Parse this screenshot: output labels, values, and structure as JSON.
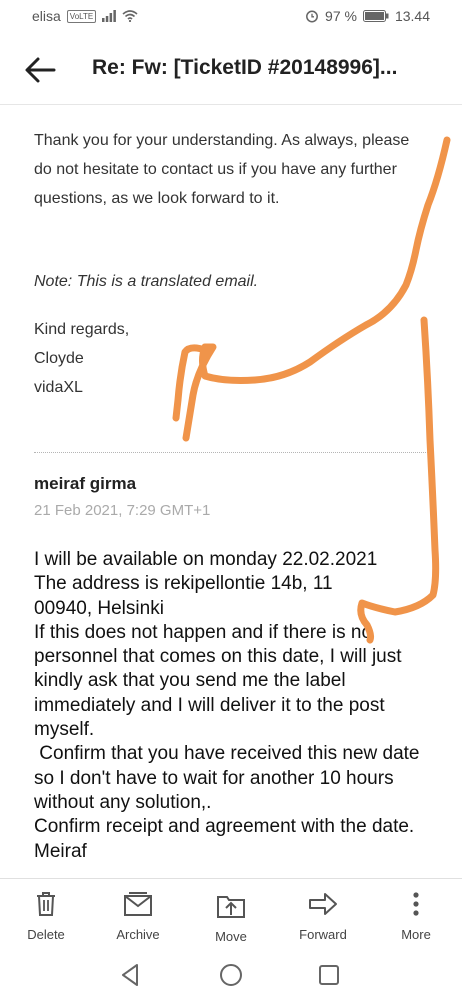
{
  "status": {
    "carrier": "elisa",
    "volte": "VoLTE",
    "battery": "97 %",
    "time": "13.44"
  },
  "header": {
    "subject": "Re: Fw: [TicketID #20148996]..."
  },
  "email": {
    "paragraph": "Thank you for your understanding. As always, please do not hesitate to contact us if you have any further questions, as we look forward to it.",
    "note": "Note: This is a translated email.",
    "closing": "Kind regards,",
    "agent_name": "Cloyde",
    "company": "vidaXL"
  },
  "reply": {
    "sender": "meiraf girma",
    "date": "21 Feb 2021, 7:29 GMT+1",
    "body": "I will be available on monday 22.02.2021\nThe address is rekipellontie 14b, 11\n00940, Helsinki\nIf this does not happen and if there is no personnel that comes on this date, I will just kindly ask that you send me the label immediately and I will deliver it to the post myself.\n Confirm that you have received this new date so I don't have to wait for another 10 hours without any solution,.\nConfirm receipt and agreement with the date.\nMeiraf"
  },
  "toolbar": {
    "delete": "Delete",
    "archive": "Archive",
    "move": "Move",
    "forward": "Forward",
    "more": "More"
  },
  "colors": {
    "annotation": "#f0944a",
    "muted": "#aaaaaa"
  },
  "icons": [
    "back-arrow-icon",
    "trash-icon",
    "archive-icon",
    "move-icon",
    "forward-arrow-icon",
    "more-vertical-icon",
    "nav-back-icon",
    "nav-home-icon",
    "nav-recents-icon",
    "alarm-icon",
    "battery-icon",
    "wifi-icon",
    "signal-icon"
  ]
}
